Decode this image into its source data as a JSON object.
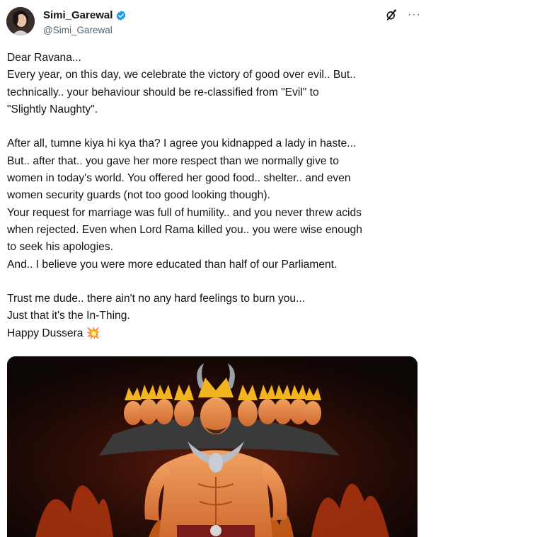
{
  "tweet": {
    "author": {
      "display_name": "Simi_Garewal",
      "handle": "@Simi_Garewal",
      "verified": true,
      "verified_color": "#1d9bf0"
    },
    "actions": {
      "grok_icon": "grok-icon",
      "more_label": "···"
    },
    "text": "Dear Ravana...\nEvery year, on this day, we celebrate the victory of good over evil.. But..\ntechnically.. your behaviour should be re-classified from \"Evil\" to\n\"Slightly Naughty\".\n\nAfter all, tumne kiya hi kya tha? I agree you kidnapped a lady in haste...\nBut.. after that.. you gave her more respect than we normally give to\nwomen in today's world. You offered her good food.. shelter.. and even\nwomen security guards (not too good looking though).\nYour request for marriage was full of humility.. and you never threw acids\nwhen rejected. Even when Lord Rama killed you.. you were wise enough\nto seek his apologies.\nAnd.. I believe you were more educated than half of our Parliament.\n\nTrust me dude.. there ain't no any hard feelings to burn you...\nJust that it's the In-Thing.\nHappy Dussera 💥",
    "media": {
      "icon": "ravana-illustration"
    }
  }
}
